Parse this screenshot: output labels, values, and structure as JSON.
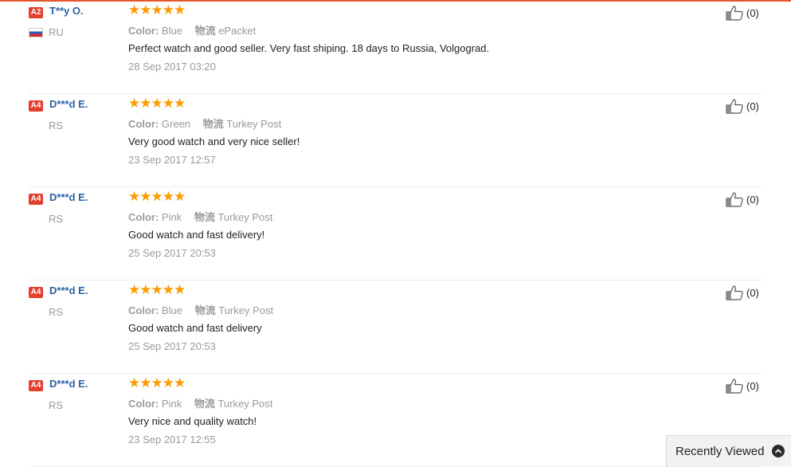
{
  "reviews": [
    {
      "badge": "A2",
      "name": "T**y O.",
      "country": "RU",
      "has_flag": true,
      "stars": "★★★★★",
      "color_label": "Color:",
      "color": "Blue",
      "ship_label": "物流",
      "shipping": "ePacket",
      "text": "Perfect watch and good seller. Very fast shiping. 18 days to Russia, Volgograd.",
      "date": "28 Sep 2017 03:20",
      "helpful": "(0)"
    },
    {
      "badge": "A4",
      "name": "D***d E.",
      "country": "RS",
      "has_flag": false,
      "stars": "★★★★★",
      "color_label": "Color:",
      "color": "Green",
      "ship_label": "物流",
      "shipping": "Turkey Post",
      "text": "Very good watch and very nice seller!",
      "date": "23 Sep 2017 12:57",
      "helpful": "(0)"
    },
    {
      "badge": "A4",
      "name": "D***d E.",
      "country": "RS",
      "has_flag": false,
      "stars": "★★★★★",
      "color_label": "Color:",
      "color": "Pink",
      "ship_label": "物流",
      "shipping": "Turkey Post",
      "text": "Good watch and fast delivery!",
      "date": "25 Sep 2017 20:53",
      "helpful": "(0)"
    },
    {
      "badge": "A4",
      "name": "D***d E.",
      "country": "RS",
      "has_flag": false,
      "stars": "★★★★★",
      "color_label": "Color:",
      "color": "Blue",
      "ship_label": "物流",
      "shipping": "Turkey Post",
      "text": "Good watch and fast delivery",
      "date": "25 Sep 2017 20:53",
      "helpful": "(0)"
    },
    {
      "badge": "A4",
      "name": "D***d E.",
      "country": "RS",
      "has_flag": false,
      "stars": "★★★★★",
      "color_label": "Color:",
      "color": "Pink",
      "ship_label": "物流",
      "shipping": "Turkey Post",
      "text": "Very nice and quality watch!",
      "date": "23 Sep 2017 12:55",
      "helpful": "(0)"
    }
  ],
  "rating_value": 5,
  "recently_viewed": {
    "label": "Recently Viewed",
    "icon": "chevron-up-icon"
  },
  "colors": {
    "accent": "#e4572e",
    "star": "#ff9a00",
    "name": "#2a63a5",
    "badge": "#e33f2e"
  }
}
